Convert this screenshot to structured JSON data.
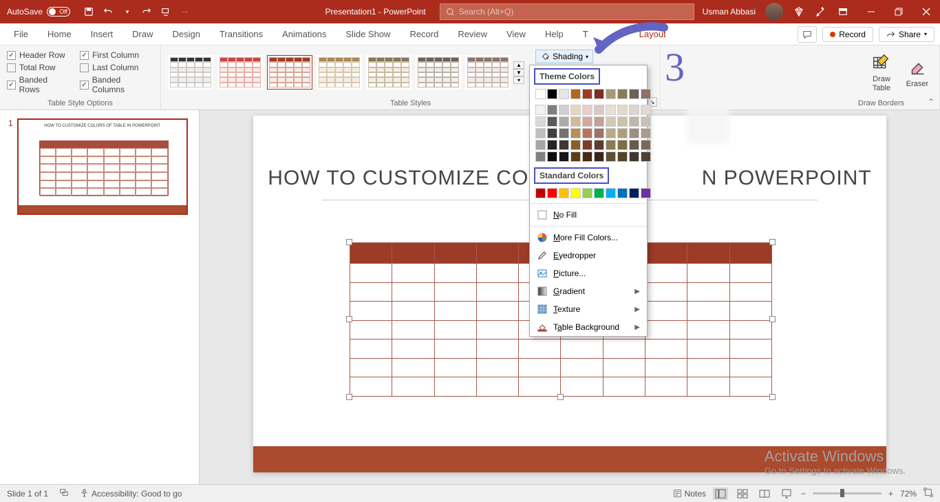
{
  "titlebar": {
    "autosave_label": "AutoSave",
    "autosave_state": "Off",
    "doc_title": "Presentation1 - PowerPoint",
    "search_placeholder": "Search (Alt+Q)",
    "user_name": "Usman Abbasi"
  },
  "tabs": {
    "file": "File",
    "home": "Home",
    "insert": "Insert",
    "draw": "Draw",
    "design": "Design",
    "transitions": "Transitions",
    "animations": "Animations",
    "slideshow": "Slide Show",
    "record": "Record",
    "review": "Review",
    "view": "View",
    "help": "Help",
    "table_design": "T",
    "layout": "Layout",
    "rec_btn": "Record",
    "share_btn": "Share"
  },
  "style_opts": {
    "header_row": "Header Row",
    "first_col": "First Column",
    "total_row": "Total Row",
    "last_col": "Last Column",
    "banded_rows": "Banded Rows",
    "banded_cols": "Banded Columns",
    "group_label": "Table Style Options"
  },
  "table_styles_label": "Table Styles",
  "shading_label": "Shading",
  "draw_borders": {
    "group": "Draw Borders",
    "draw_table": "Draw\nTable",
    "eraser": "Eraser"
  },
  "shading_menu": {
    "theme": "Theme Colors",
    "standard": "Standard Colors",
    "no_fill": "No Fill",
    "more": "More Fill Colors...",
    "eyedrop": "Eyedropper",
    "picture": "Picture...",
    "gradient": "Gradient",
    "texture": "Texture",
    "bg": "Table Background",
    "theme_row": [
      "#ffffff",
      "#000000",
      "#e7e6e6",
      "#b5651d",
      "#9c3b28",
      "#7b3025",
      "#a89878",
      "#8a7a5a",
      "#6b6055",
      "#8a7268"
    ],
    "theme_shades": [
      [
        "#f2f2f2",
        "#7f7f7f",
        "#d0cece",
        "#e8d5be",
        "#e9cfc8",
        "#dcc7c1",
        "#e6e1d4",
        "#e0dbcb",
        "#d9d5d0",
        "#e0d9d4"
      ],
      [
        "#d9d9d9",
        "#595959",
        "#aeaaaa",
        "#d4b995",
        "#d4a89b",
        "#c1a299",
        "#d3cab4",
        "#cbc2a8",
        "#bfb7ae",
        "#cbbfb5"
      ],
      [
        "#bfbfbf",
        "#404040",
        "#757171",
        "#b98e58",
        "#b7735f",
        "#9c7368",
        "#b7aa87",
        "#ad9f7c",
        "#9b9084",
        "#ad9b8c"
      ],
      [
        "#a6a6a6",
        "#262626",
        "#3b3838",
        "#8a5f2a",
        "#7b3d2a",
        "#5d3b30",
        "#8a7c55",
        "#7d6e48",
        "#665b4e",
        "#7d6857"
      ],
      [
        "#808080",
        "#0d0d0d",
        "#161616",
        "#5c3d16",
        "#4e2418",
        "#3b231b",
        "#5c5033",
        "#52452a",
        "#403830",
        "#4f4034"
      ]
    ],
    "standard_row": [
      "#c00000",
      "#ff0000",
      "#ffc000",
      "#ffff00",
      "#92d050",
      "#00b050",
      "#00b0f0",
      "#0070c0",
      "#002060",
      "#7030a0"
    ]
  },
  "slide": {
    "title": "HOW TO CUSTOMIZE COLORS OF TABLE IN POWERPOINT",
    "thumb_title": "HOW TO CUSTOMIZE COLORS OF   TABLE IN POWERPOINT"
  },
  "annotation_number": "3",
  "watermark": {
    "t": "Activate Windows",
    "s": "Go to Settings to activate Windows."
  },
  "status": {
    "slide": "Slide 1 of 1",
    "acc": "Accessibility: Good to go",
    "notes": "Notes",
    "zoom": "72%"
  }
}
